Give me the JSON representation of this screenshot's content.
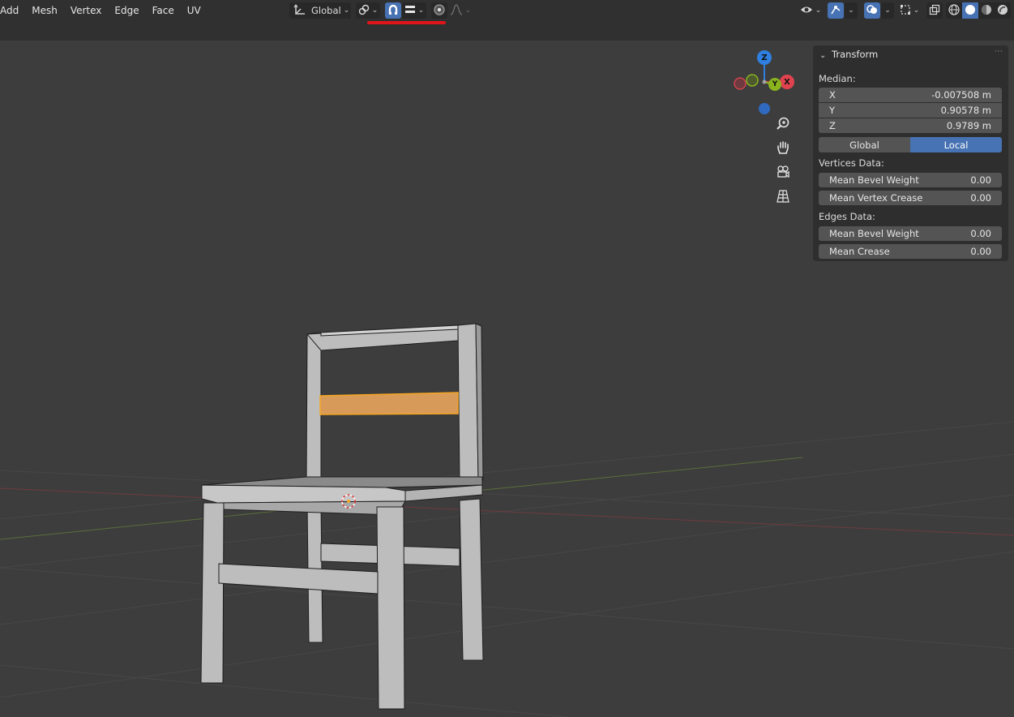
{
  "menu": {
    "items": [
      "Add",
      "Mesh",
      "Vertex",
      "Edge",
      "Face",
      "UV"
    ]
  },
  "toolbar": {
    "transform_orientation": "Global",
    "pivot_icon": "pivot-icon",
    "snap_icon": "magnet-snap-icon",
    "snap_target_icon": "snap-increment-icon",
    "proportional_icon": "proportional-edit-icon",
    "falloff_icon": "falloff-curve-icon",
    "snap_enabled": true
  },
  "header_right": {
    "icons": [
      "visibility-icon",
      "gizmo-icon",
      "overlay-icon",
      "xray-selection-icon",
      "xray-icon",
      "wireframe-shading-icon",
      "solid-shading-icon",
      "material-shading-icon",
      "rendered-shading-icon"
    ]
  },
  "gizmo": {
    "z": "Z",
    "x": "X",
    "y": "Y"
  },
  "n_panel": {
    "title": "Transform",
    "median_label": "Median:",
    "median": [
      {
        "axis": "X",
        "value": "-0.007508 m"
      },
      {
        "axis": "Y",
        "value": "0.90578 m"
      },
      {
        "axis": "Z",
        "value": "0.9789 m"
      }
    ],
    "space_options": [
      "Global",
      "Local"
    ],
    "space_selected": "Local",
    "vertices_label": "Vertices Data:",
    "vertices": [
      {
        "label": "Mean Bevel Weight",
        "value": "0.00"
      },
      {
        "label": "Mean Vertex Crease",
        "value": "0.00"
      }
    ],
    "edges_label": "Edges Data:",
    "edges": [
      {
        "label": "Mean Bevel Weight",
        "value": "0.00"
      },
      {
        "label": "Mean Crease",
        "value": "0.00"
      }
    ]
  },
  "colors": {
    "accent": "#4772b3",
    "selection": "#f5a623",
    "highlight_line": "#e0141b",
    "x_axis": "#e0434e",
    "y_axis": "#8ab31e",
    "z_axis": "#2f7fe0"
  }
}
